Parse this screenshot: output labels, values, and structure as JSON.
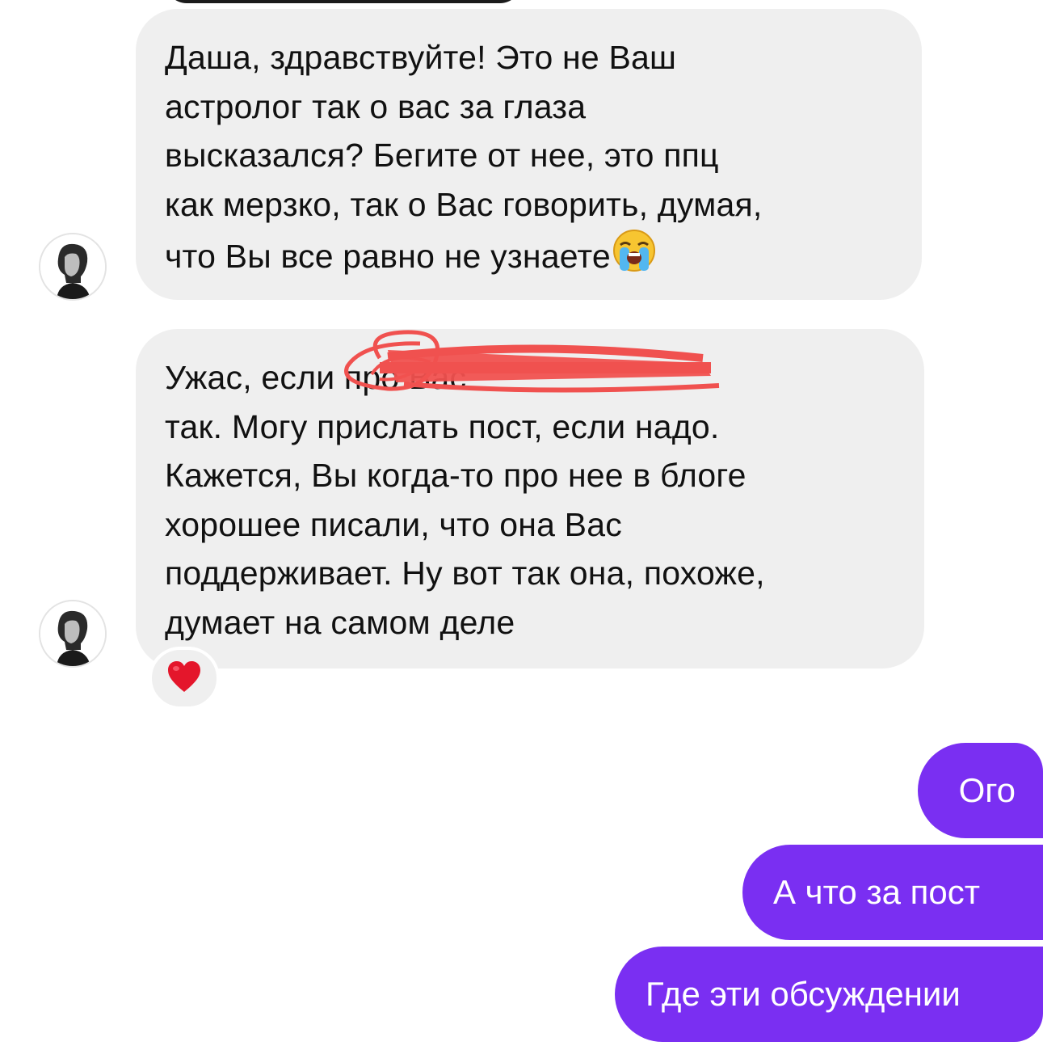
{
  "conversation": {
    "incoming": [
      {
        "text": "Даша, здравствуйте! Это не Ваш\nастролог так о вас за глаза\nвысказался? Бегите от нее, это ппц\nкак мерзко, так о Вас говорить, думая,\nчто Вы все равно не узнаете",
        "trailing_emoji": "loudly-crying-face-emoji"
      },
      {
        "text": "Ужас, если                                    про Вас\nтак. Могу прислать пост, если надо.\nКажется, Вы когда-то про нее в блоге\nхорошее писали, что она Вас\nподдерживает. Ну вот так она, похоже,\nдумает на самом деле",
        "reaction": "red-heart-emoji"
      }
    ],
    "outgoing": [
      {
        "text": "Ого"
      },
      {
        "text": "А что за пост"
      },
      {
        "text": "Где эти обсуждении"
      }
    ]
  },
  "colors": {
    "incoming_bubble": "#efefef",
    "outgoing_bubble": "#7a2ff2",
    "redaction_scribble": "#f0514f"
  }
}
